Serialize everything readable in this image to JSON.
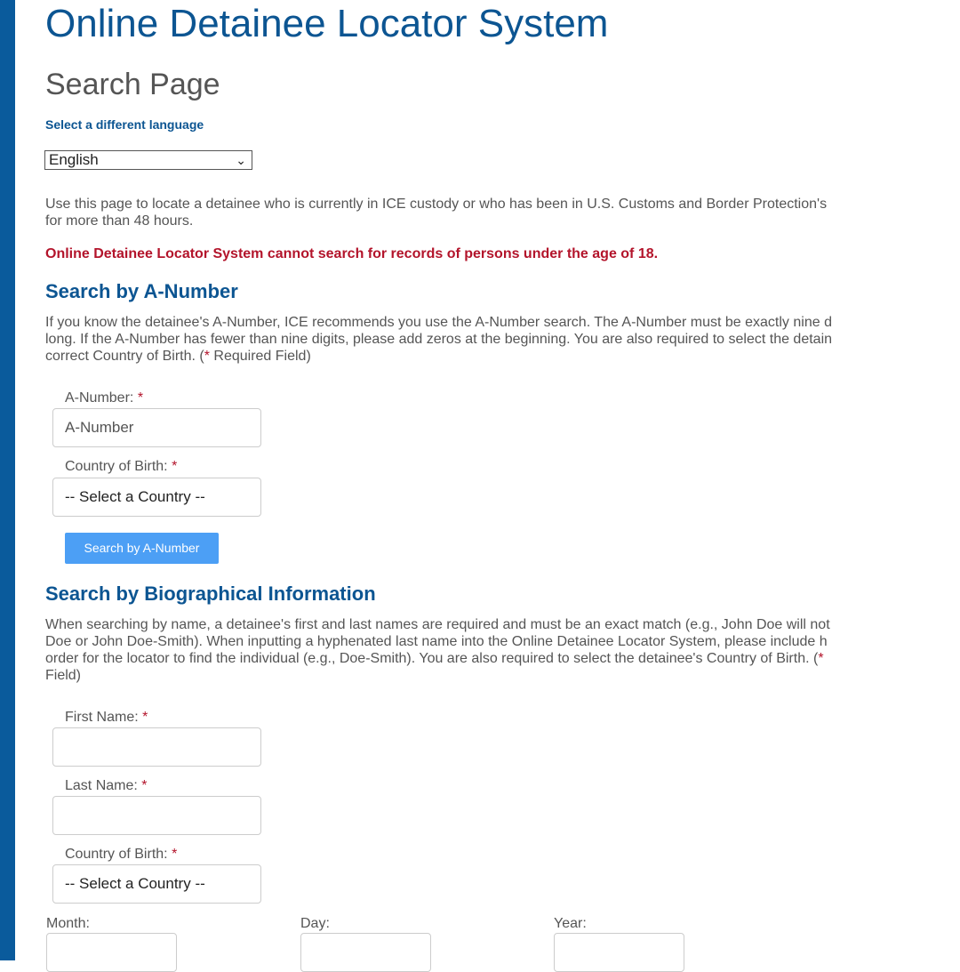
{
  "header": {
    "title": "Online Detainee Locator System",
    "subtitle": "Search Page",
    "language_link": "Select a different language",
    "language_selected": "English"
  },
  "intro": {
    "line1": "Use this page to locate a detainee who is currently in ICE custody or who has been in U.S. Customs and Border Protection's",
    "line2": "for more than 48 hours.",
    "warning": "Online Detainee Locator System cannot search for records of persons under the age of 18."
  },
  "anumber_section": {
    "title": "Search by A-Number",
    "line1": "If you know the detainee's A-Number, ICE recommends you use the A-Number search. The A-Number must be exactly nine d",
    "line2": "long. If the A-Number has fewer than nine digits, please add zeros at the beginning. You are also required to select the detain",
    "line3_pre": "correct Country of Birth. (",
    "line3_star": "*",
    "line3_post": " Required Field)",
    "anumber_label": "A-Number:",
    "anumber_placeholder": "A-Number",
    "country_label": "Country of Birth:",
    "country_value": "-- Select a Country --",
    "button": "Search by A-Number"
  },
  "bio_section": {
    "title": "Search by Biographical Information",
    "line1": "When searching by name, a detainee's first and last names are required and must be an exact match (e.g., John Doe will not",
    "line2": "Doe or John Doe-Smith). When inputting a hyphenated last name into the Online Detainee Locator System, please include h",
    "line3_pre": "order for the locator to find the individual (e.g., Doe-Smith). You are also required to select the detainee's Country of Birth. (",
    "line3_star": "*",
    "line4": "Field)",
    "first_name_label": "First Name:",
    "first_name_value": "",
    "last_name_label": "Last Name:",
    "last_name_value": "",
    "country_label": "Country of Birth:",
    "country_value": "-- Select a Country --",
    "month_label": "Month:",
    "day_label": "Day:",
    "year_label": "Year:"
  },
  "required_marker": "*",
  "colors": {
    "brand_blue": "#0c5592",
    "sidebar_blue": "#0a5b9c",
    "warning_red": "#b3142b",
    "button_blue": "#4c9ff5"
  }
}
